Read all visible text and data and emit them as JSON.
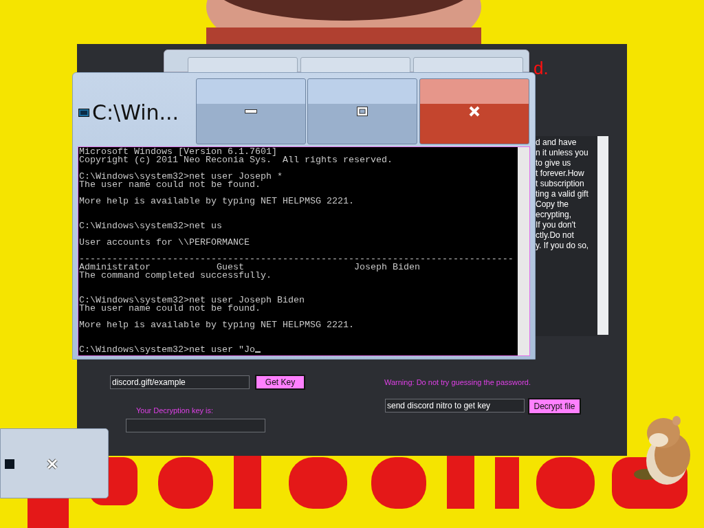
{
  "app": {
    "title_fragment": "d.",
    "message_lines": [
      "d and have",
      "n it unless you",
      "to give us",
      "t forever.How",
      "t subscription",
      "ting a valid gift",
      "Copy the",
      "ecrypting,",
      "If you don't",
      "ctly.Do not",
      "y. If you do so,"
    ],
    "gift_code_field": {
      "value": "discord.gift/example"
    },
    "get_key_button": "Get Key",
    "warning": "Warning: Do not try guessing the password.",
    "key_field": {
      "value": "send discord nitro to get key"
    },
    "decrypt_button": "Decrypt file",
    "decryption_key_label": "Your Decryption key is:"
  },
  "console": {
    "title": "C:\\Win...",
    "lines": [
      {
        "kind": "text",
        "text": "Microsoft Windows [Version 6.1.7601]"
      },
      {
        "kind": "text",
        "text": "Copyright (c) 2011 Neo Reconia Sys.  All rights reserved."
      },
      {
        "kind": "blank"
      },
      {
        "kind": "text",
        "text": "C:\\Windows\\system32>net user Joseph *"
      },
      {
        "kind": "text",
        "text": "The user name could not be found."
      },
      {
        "kind": "blank"
      },
      {
        "kind": "text",
        "text": "More help is available by typing NET HELPMSG 2221."
      },
      {
        "kind": "blank"
      },
      {
        "kind": "blank"
      },
      {
        "kind": "text",
        "text": "C:\\Windows\\system32>net us"
      },
      {
        "kind": "blank"
      },
      {
        "kind": "text",
        "text": "User accounts for \\\\PERFORMANCE"
      },
      {
        "kind": "blank"
      },
      {
        "kind": "text",
        "text": "-------------------------------------------------------------------------------"
      },
      {
        "kind": "text",
        "text": "Administrator            Guest                    Joseph Biden"
      },
      {
        "kind": "text",
        "text": "The command completed successfully."
      },
      {
        "kind": "blank"
      },
      {
        "kind": "blank"
      },
      {
        "kind": "text",
        "text": "C:\\Windows\\system32>net user Joseph Biden"
      },
      {
        "kind": "text",
        "text": "The user name could not be found."
      },
      {
        "kind": "blank"
      },
      {
        "kind": "text",
        "text": "More help is available by typing NET HELPMSG 2221."
      },
      {
        "kind": "blank"
      },
      {
        "kind": "blank"
      },
      {
        "kind": "prompt",
        "text": "C:\\Windows\\system32>net user \"Jo"
      }
    ]
  }
}
